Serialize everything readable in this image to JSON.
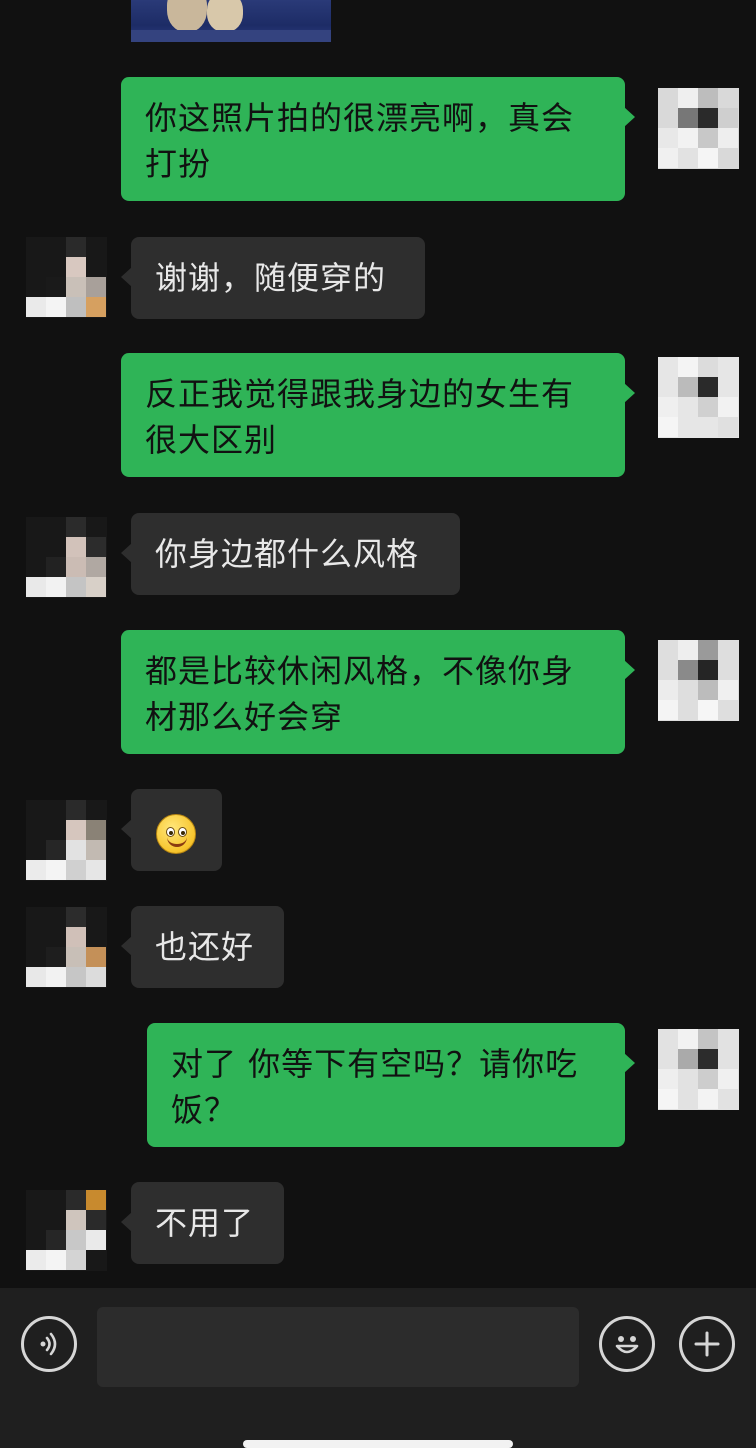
{
  "messages": [
    {
      "from": "me",
      "text": "你这照片拍的很漂亮啊，真会打扮"
    },
    {
      "from": "her",
      "text": "谢谢，随便穿的"
    },
    {
      "from": "me",
      "text": "反正我觉得跟我身边的女生有很大区别"
    },
    {
      "from": "her",
      "text": "你身边都什么风格"
    },
    {
      "from": "me",
      "text": "都是比较休闲风格，不像你身材那么好会穿"
    },
    {
      "from": "her",
      "emoji": "smiley-emoji"
    },
    {
      "from": "her",
      "text": "也还好"
    },
    {
      "from": "me",
      "text": "对了 你等下有空吗？请你吃饭？"
    },
    {
      "from": "her",
      "text": "不用了"
    }
  ],
  "input_bar": {
    "voice_icon": "voice-icon",
    "emoji_icon": "emoji-icon",
    "plus_icon": "plus-icon",
    "input_value": ""
  },
  "colors": {
    "background": "#111111",
    "my_bubble": "#2fb457",
    "her_bubble": "#2e2e2e",
    "input_bar": "#1f1f1f"
  }
}
